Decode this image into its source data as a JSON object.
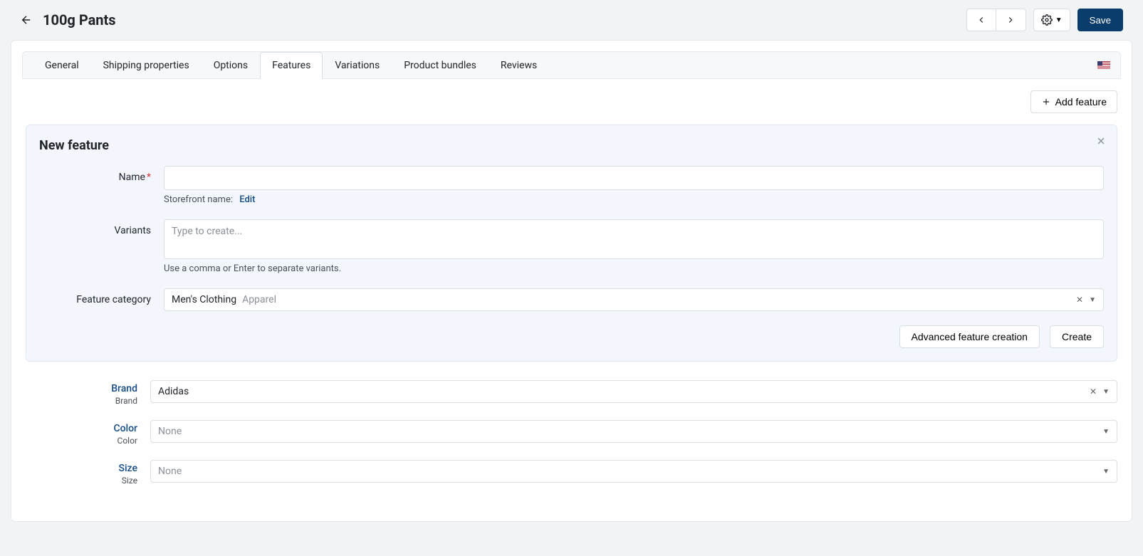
{
  "header": {
    "title": "100g Pants",
    "saveLabel": "Save"
  },
  "tabs": [
    {
      "label": "General",
      "active": false
    },
    {
      "label": "Shipping properties",
      "active": false
    },
    {
      "label": "Options",
      "active": false
    },
    {
      "label": "Features",
      "active": true
    },
    {
      "label": "Variations",
      "active": false
    },
    {
      "label": "Product bundles",
      "active": false
    },
    {
      "label": "Reviews",
      "active": false
    }
  ],
  "addFeatureLabel": "Add feature",
  "newFeature": {
    "title": "New feature",
    "nameLabel": "Name",
    "storefrontNameLabel": "Storefront name:",
    "editLabel": "Edit",
    "variantsLabel": "Variants",
    "variantsPlaceholder": "Type to create...",
    "variantsHint": "Use a comma or Enter to separate variants.",
    "categoryLabel": "Feature category",
    "categoryValue": "Men's Clothing",
    "categoryParent": "Apparel",
    "advancedBtn": "Advanced feature creation",
    "createBtn": "Create"
  },
  "featureRows": [
    {
      "label": "Brand",
      "sub": "Brand",
      "value": "Adidas",
      "clearable": true
    },
    {
      "label": "Color",
      "sub": "Color",
      "value": "None",
      "placeholder": true
    },
    {
      "label": "Size",
      "sub": "Size",
      "value": "None",
      "placeholder": true
    }
  ]
}
